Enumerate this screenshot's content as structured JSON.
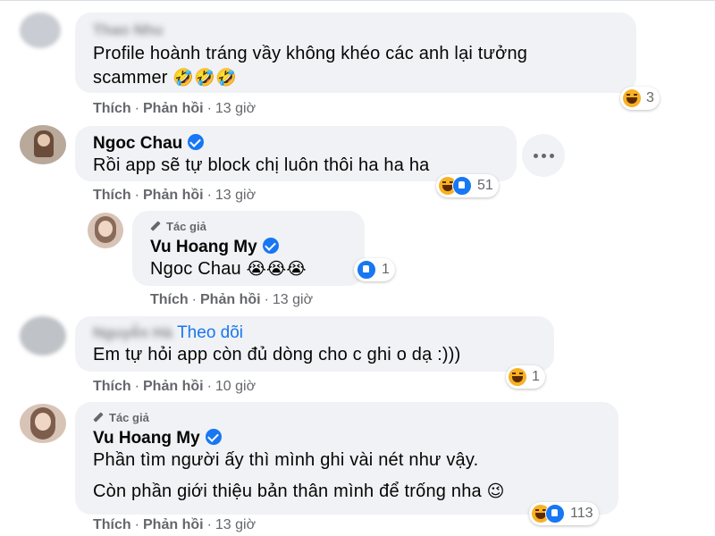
{
  "comments": [
    {
      "author_blurred": "Thao Nhu",
      "text_line1": "Profile hoành tráng vầy không khéo các anh lại tưởng",
      "text_line2": "scammer",
      "emoji": "🤣🤣🤣",
      "actions": {
        "like": "Thích",
        "reply": "Phản hồi",
        "time": "13 giờ"
      },
      "reaction_count": "3"
    },
    {
      "author": "Ngoc Chau",
      "text": "Rồi app sẽ tự block chị luôn thôi ha ha ha",
      "actions": {
        "like": "Thích",
        "reply": "Phản hồi",
        "time": "13 giờ"
      },
      "reaction_count": "51"
    },
    {
      "author_tag": "Tác giả",
      "author": "Vu Hoang My",
      "text": "Ngoc Chau",
      "emoji": "😭😭😭",
      "actions": {
        "like": "Thích",
        "reply": "Phản hồi",
        "time": "13 giờ"
      },
      "reaction_count": "1"
    },
    {
      "author_blurred": "Nguyễn Hà",
      "follow": "Theo dõi",
      "text": "Em tự hỏi app còn đủ dòng cho c ghi o dạ :)))",
      "actions": {
        "like": "Thích",
        "reply": "Phản hồi",
        "time": "10 giờ"
      },
      "reaction_count": "1"
    },
    {
      "author_tag": "Tác giả",
      "author": "Vu Hoang My",
      "text_line1": "Phần tìm người ấy thì mình ghi vài nét như vậy.",
      "text_line2": "Còn phần giới thiệu bản thân mình để trống nha",
      "emoji": "😉",
      "actions": {
        "like": "Thích",
        "reply": "Phản hồi",
        "time": "13 giờ"
      },
      "reaction_count": "113"
    }
  ],
  "icons": {
    "reaction_haha": "haha-icon",
    "reaction_like": "like-icon",
    "more": "ellipsis-icon",
    "author_badge": "pen-icon",
    "verified": "verified-badge-icon"
  },
  "colors": {
    "bubble": "#f0f2f5",
    "link": "#1877f2",
    "secondary_text": "#65676b",
    "haha": "#f7b125"
  }
}
